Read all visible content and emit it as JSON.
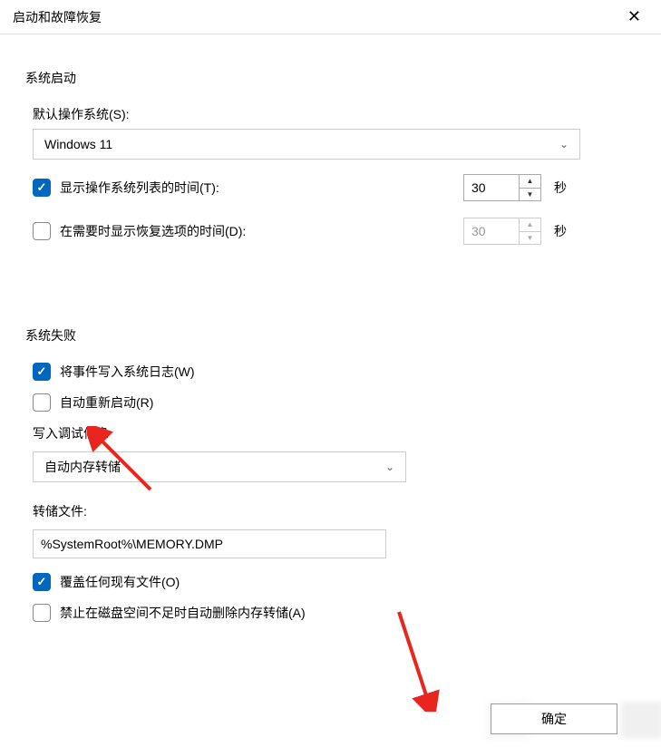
{
  "window": {
    "title": "启动和故障恢复"
  },
  "startup": {
    "section_title": "系统启动",
    "default_os_label": "默认操作系统(S):",
    "default_os_value": "Windows 11",
    "show_os_list_label": "显示操作系统列表的时间(T):",
    "show_os_list_checked": true,
    "show_os_list_seconds": "30",
    "show_recovery_label": "在需要时显示恢复选项的时间(D):",
    "show_recovery_checked": false,
    "show_recovery_seconds": "30",
    "seconds_unit": "秒"
  },
  "failure": {
    "section_title": "系统失败",
    "write_event_label": "将事件写入系统日志(W)",
    "write_event_checked": true,
    "auto_restart_label": "自动重新启动(R)",
    "auto_restart_checked": false,
    "debug_info_label": "写入调试信息",
    "debug_info_value": "自动内存转储",
    "dump_file_label": "转储文件:",
    "dump_file_value": "%SystemRoot%\\MEMORY.DMP",
    "overwrite_label": "覆盖任何现有文件(O)",
    "overwrite_checked": true,
    "disable_low_disk_label": "禁止在磁盘空间不足时自动删除内存转储(A)",
    "disable_low_disk_checked": false
  },
  "buttons": {
    "ok": "确定"
  }
}
